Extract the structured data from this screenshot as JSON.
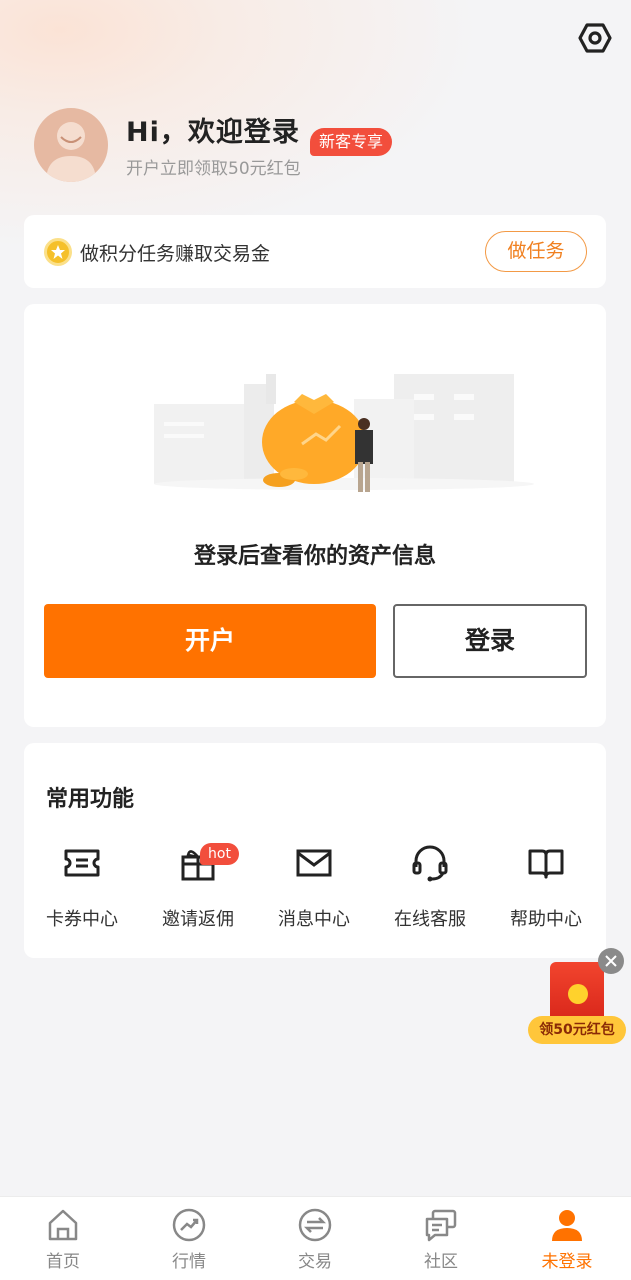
{
  "header": {
    "settings_icon": "settings-hex-icon"
  },
  "profile": {
    "greeting": "Hi，欢迎登录",
    "badge": "新客专享",
    "subtitle": "开户立即领取50元红包"
  },
  "task": {
    "text": "做积分任务赚取交易金",
    "button": "做任务"
  },
  "asset": {
    "message": "登录后查看你的资产信息",
    "open_account": "开户",
    "login": "登录"
  },
  "functions": {
    "title": "常用功能",
    "hot_badge": "hot",
    "items": [
      {
        "label": "卡券中心",
        "icon": "coupon-icon"
      },
      {
        "label": "邀请返佣",
        "icon": "gift-icon"
      },
      {
        "label": "消息中心",
        "icon": "mail-icon"
      },
      {
        "label": "在线客服",
        "icon": "headset-icon"
      },
      {
        "label": "帮助中心",
        "icon": "book-icon"
      }
    ]
  },
  "floating": {
    "label": "领50元红包"
  },
  "tabbar": {
    "items": [
      {
        "label": "首页",
        "icon": "home-icon"
      },
      {
        "label": "行情",
        "icon": "trend-icon"
      },
      {
        "label": "交易",
        "icon": "exchange-icon"
      },
      {
        "label": "社区",
        "icon": "chat-icon"
      },
      {
        "label": "未登录",
        "icon": "user-icon",
        "active": true
      }
    ]
  },
  "colors": {
    "accent": "#ff7200",
    "badge_red": "#f24e3c",
    "background": "#f4f4f6"
  }
}
